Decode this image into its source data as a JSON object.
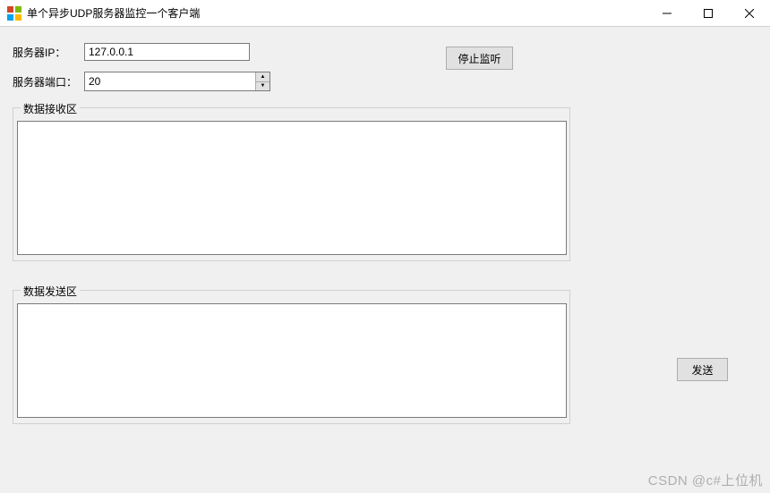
{
  "window": {
    "title": "单个异步UDP服务器监控一个客户端"
  },
  "fields": {
    "server_ip_label": "服务器IP：",
    "server_ip_value": "127.0.0.1",
    "server_port_label": "服务器端口：",
    "server_port_value": "20"
  },
  "buttons": {
    "stop_listen": "停止监听",
    "send": "发送"
  },
  "groups": {
    "receive_area": "数据接收区",
    "send_area": "数据发送区"
  },
  "textareas": {
    "receive_value": "",
    "send_value": ""
  },
  "watermark": "CSDN @c#上位机"
}
